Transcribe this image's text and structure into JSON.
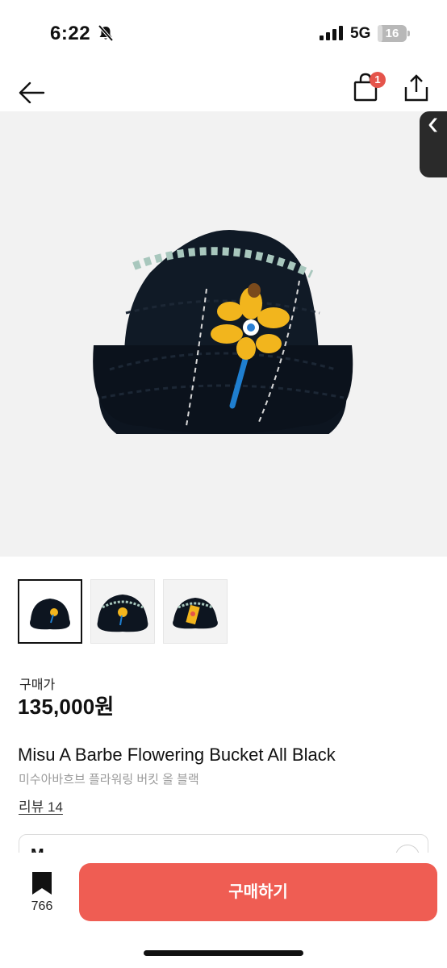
{
  "status_bar": {
    "time": "6:22",
    "network": "5G",
    "battery": "16",
    "battery_level": 0.16
  },
  "nav": {
    "cart_count": "1",
    "icons": [
      "back-arrow-icon",
      "shopping-bag-icon",
      "share-icon"
    ]
  },
  "thumbnails": [
    {
      "name": "thumb-1",
      "selected": true
    },
    {
      "name": "thumb-2",
      "selected": false
    },
    {
      "name": "thumb-3",
      "selected": false
    }
  ],
  "product": {
    "price_label": "구매가",
    "price": "135,000원",
    "name": "Misu A Barbe Flowering Bucket All Black",
    "name_ko": "미수아바흐브 플라워링 버킷 올 블랙",
    "review": "리뷰 14",
    "size_value": "M"
  },
  "bottom": {
    "bookmark_count": "766",
    "buy_label": "구매하기"
  },
  "colors": {
    "accent": "#ef5d53",
    "badge": "#e5544b",
    "hat": "#0d1520",
    "flower": "#f2b51d"
  }
}
